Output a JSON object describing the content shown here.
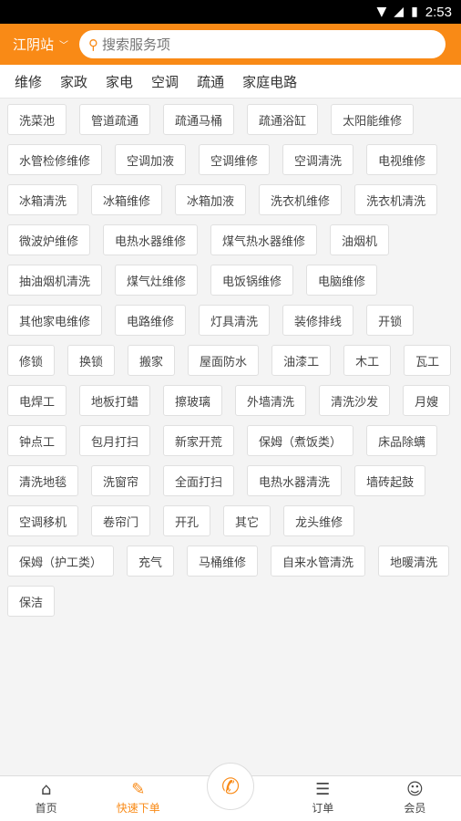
{
  "status_bar": {
    "time": "2:53"
  },
  "header": {
    "city": "江阴站",
    "search_placeholder": "搜索服务项"
  },
  "categories": [
    "维修",
    "家政",
    "家电",
    "空调",
    "疏通",
    "家庭电路"
  ],
  "services": [
    "洗菜池",
    "管道疏通",
    "疏通马桶",
    "疏通浴缸",
    "太阳能维修",
    "水管检修维修",
    "空调加液",
    "空调维修",
    "空调清洗",
    "电视维修",
    "冰箱清洗",
    "冰箱维修",
    "冰箱加液",
    "洗衣机维修",
    "洗衣机清洗",
    "微波炉维修",
    "电热水器维修",
    "煤气热水器维修",
    "油烟机",
    "抽油烟机清洗",
    "煤气灶维修",
    "电饭锅维修",
    "电脑维修",
    "其他家电维修",
    "电路维修",
    "灯具清洗",
    "装修排线",
    "开锁",
    "修锁",
    "换锁",
    "搬家",
    "屋面防水",
    "油漆工",
    "木工",
    "瓦工",
    "电焊工",
    "地板打蜡",
    "擦玻璃",
    "外墙清洗",
    "清洗沙发",
    "月嫂",
    "钟点工",
    "包月打扫",
    "新家开荒",
    "保姆（煮饭类）",
    "床品除螨",
    "清洗地毯",
    "洗窗帘",
    "全面打扫",
    "电热水器清洗",
    "墙砖起鼓",
    "空调移机",
    "卷帘门",
    "开孔",
    "其它",
    "龙头维修",
    "保姆（护工类）",
    "充气",
    "马桶维修",
    "自来水管清洗",
    "地暖清洗",
    "保洁"
  ],
  "nav": {
    "home": "首页",
    "order_quick": "快速下单",
    "orders": "订单",
    "member": "会员"
  },
  "colors": {
    "accent": "#f98a16"
  }
}
